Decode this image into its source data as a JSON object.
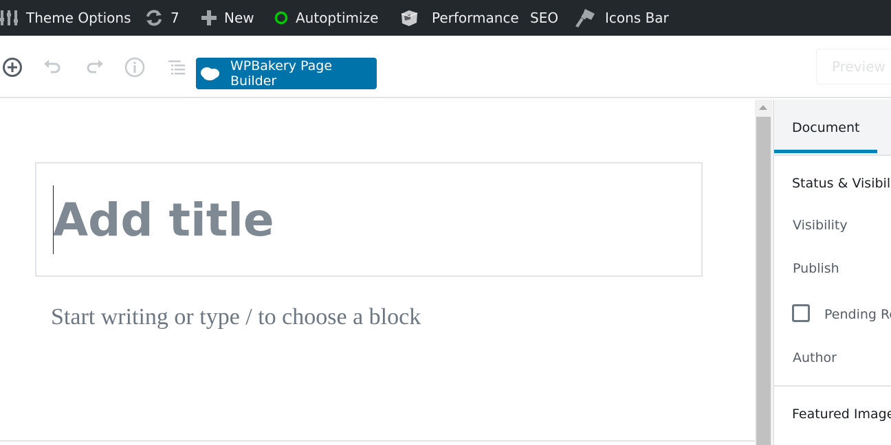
{
  "admin_bar": {
    "theme_options": "Theme Options",
    "updates_count": "7",
    "new_label": "New",
    "autoptimize": "Autoptimize",
    "autoptimize_status_color": "#00c800",
    "performance": "Performance",
    "seo": "SEO",
    "icons_bar": "Icons Bar"
  },
  "toolbar": {
    "add_block_icon": "plus-circle-icon",
    "undo_icon": "undo-icon",
    "redo_icon": "redo-icon",
    "info_icon": "info-icon",
    "outline_icon": "list-icon",
    "wpbakery_label": "WPBakery Page Builder",
    "wpbakery_color": "#0073aa",
    "preview_label": "Preview"
  },
  "editor": {
    "title_placeholder": "Add title",
    "block_placeholder": "Start writing or type / to choose a block"
  },
  "sidebar": {
    "tabs": [
      {
        "label": "Document",
        "active": true
      }
    ],
    "accent_color": "#0085ba",
    "status_section": {
      "heading": "Status & Visibil",
      "visibility_label": "Visibility",
      "publish_label": "Publish",
      "pending_review_label": "Pending Re",
      "pending_review_checked": false,
      "author_label": "Author"
    },
    "featured_image_heading": "Featured Image"
  }
}
